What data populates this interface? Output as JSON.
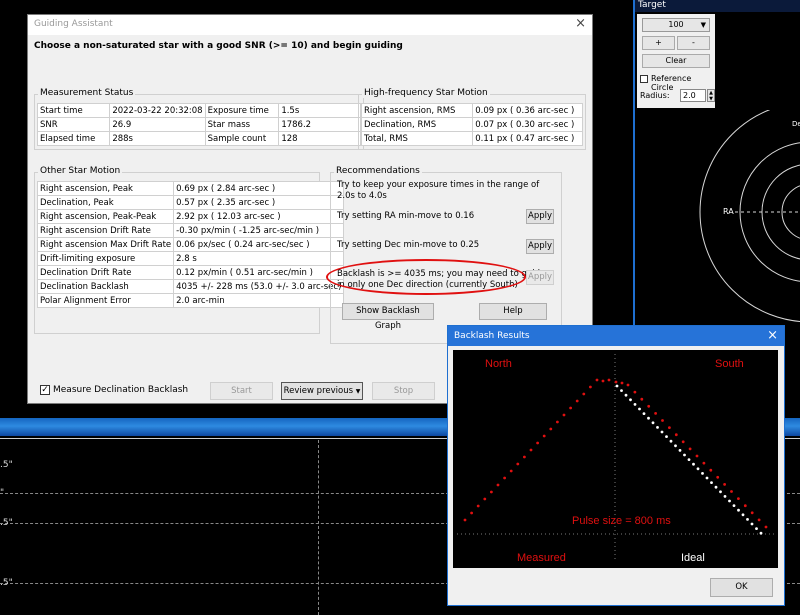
{
  "guiding_assistant": {
    "title": "Guiding Assistant",
    "close_symbol": "×",
    "heading": "Choose a non-saturated star with a good SNR (>= 10) and begin guiding",
    "measurement_status": {
      "title": "Measurement Status",
      "rows": [
        [
          "Start time",
          "2022-03-22 20:32:08",
          "Exposure time",
          "1.5s"
        ],
        [
          "SNR",
          "26.9",
          "Star mass",
          "1786.2"
        ],
        [
          "Elapsed time",
          "288s",
          "Sample count",
          "128"
        ]
      ]
    },
    "high_frequency": {
      "title": "High-frequency Star Motion",
      "rows": [
        [
          "Right ascension, RMS",
          "0.09 px ( 0.36 arc-sec )"
        ],
        [
          "Declination, RMS",
          "0.07 px ( 0.30 arc-sec )"
        ],
        [
          "Total, RMS",
          "0.11 px ( 0.47 arc-sec )"
        ]
      ]
    },
    "other_motion": {
      "title": "Other Star Motion",
      "rows": [
        [
          "Right ascension, Peak",
          "0.69 px ( 2.84 arc-sec )"
        ],
        [
          "Declination, Peak",
          "0.57 px ( 2.35 arc-sec )"
        ],
        [
          "Right ascension, Peak-Peak",
          "2.92 px ( 12.03 arc-sec )"
        ],
        [
          "Right ascension Drift Rate",
          "-0.30 px/min ( -1.25 arc-sec/min )"
        ],
        [
          "Right ascension Max Drift Rate",
          "0.06 px/sec ( 0.24 arc-sec/sec )"
        ],
        [
          "Drift-limiting exposure",
          "2.8 s"
        ],
        [
          "Declination Drift Rate",
          "0.12 px/min ( 0.51 arc-sec/min )"
        ],
        [
          "Declination Backlash",
          "4035 +/- 228 ms (53.0 +/- 3.0 arc-sec)"
        ],
        [
          "Polar Alignment Error",
          "2.0 arc-min"
        ]
      ]
    },
    "recommendations": {
      "title": "Recommendations",
      "exposure_line1": "Try to keep your exposure times in the range of",
      "exposure_line2": "2.0s to 4.0s",
      "ra_text": "Try setting RA min-move to 0.16",
      "dec_text": "Try setting Dec min-move to 0.25",
      "backlash_line1": "Backlash is >= 4035 ms; you may need to guide",
      "backlash_line2": "in only one Dec direction (currently South)",
      "apply_label": "Apply",
      "show_graph_label": "Show Backlash Graph",
      "help_label": "Help"
    },
    "measure_backlash_label": "Measure Declination Backlash",
    "measure_backlash_checked": true,
    "start_label": "Start",
    "review_label": "Review previous",
    "stop_label": "Stop"
  },
  "target_panel": {
    "title": "Target",
    "zoom_value": "100",
    "plus_label": "+",
    "minus_label": "-",
    "clear_label": "Clear",
    "reference_circle_label": "Reference Circle",
    "radius_label": "Radius:",
    "radius_value": "2.0",
    "ra_label": "RA",
    "dec_label": "Dec"
  },
  "graph": {
    "tick_labels": [
      ".5\"",
      "\"",
      ".5\"",
      ".5\""
    ]
  },
  "backlash_results": {
    "title": "Backlash Results",
    "close_symbol": "×",
    "north_label": "North",
    "south_label": "South",
    "pulse_label": "Pulse size = 800 ms",
    "measured_label": "Measured",
    "ideal_label": "Ideal",
    "ok_label": "OK"
  },
  "colors": {
    "accent": "#2673d8",
    "measured": "#e01010",
    "ideal": "#ffffff",
    "highlight_oval": "#e01010"
  }
}
